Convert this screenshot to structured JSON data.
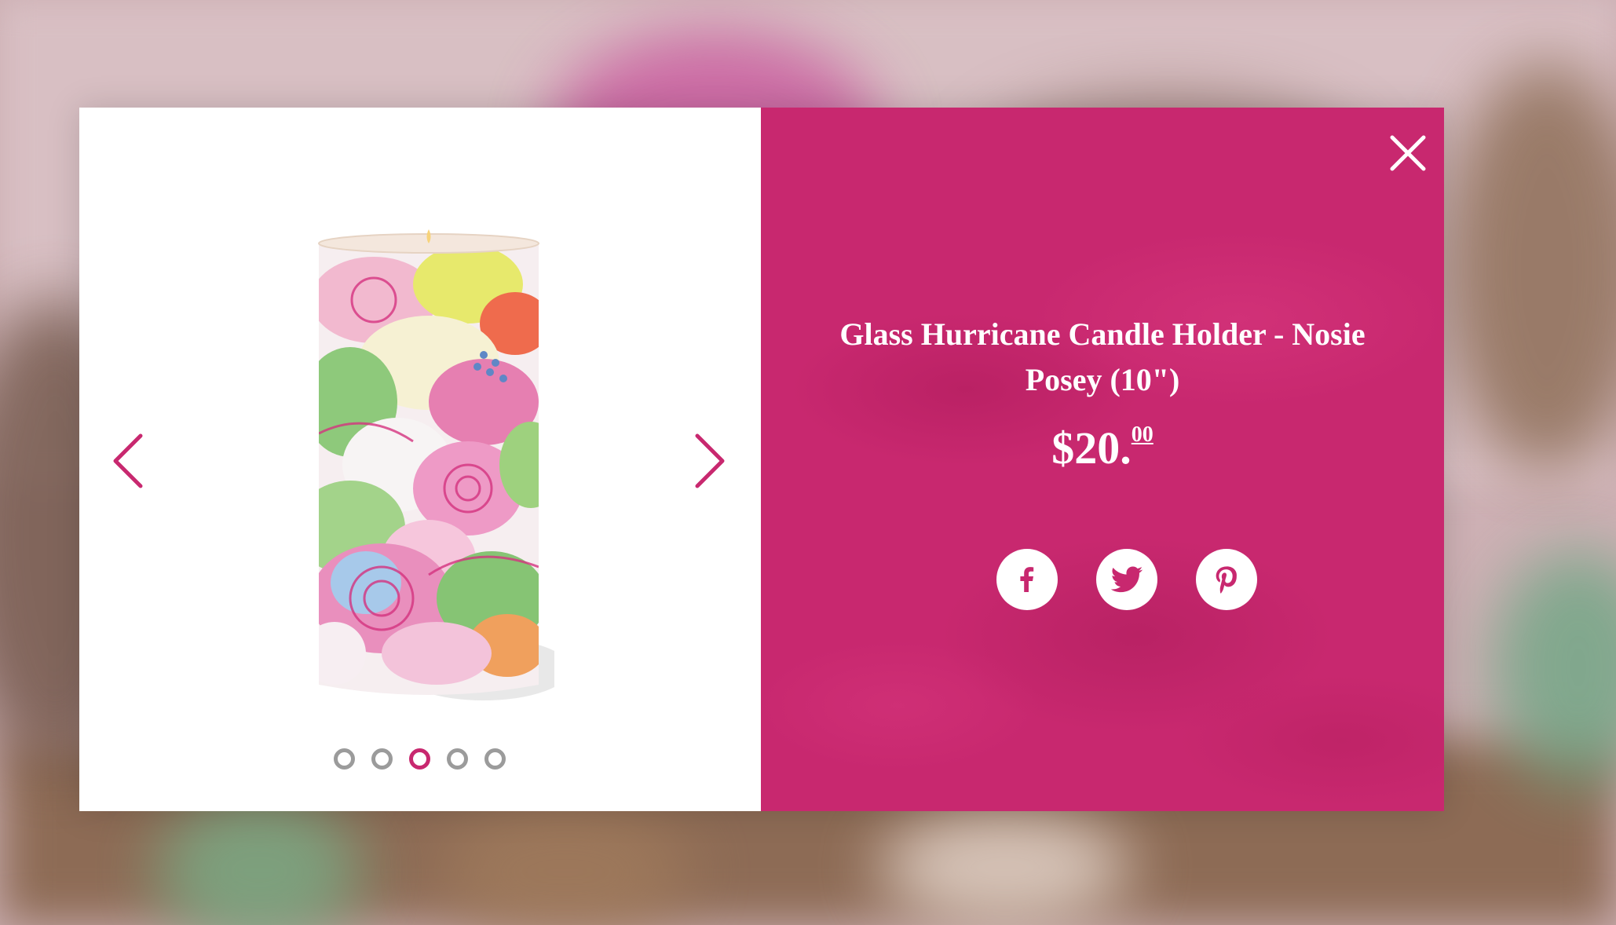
{
  "product": {
    "title": "Glass Hurricane Candle Holder - Nosie Posey (10\")",
    "price_main": "$20.",
    "price_cents": "00"
  },
  "gallery": {
    "slide_count": 5,
    "active_slide": 3
  },
  "colors": {
    "brand_pink": "#c8286f",
    "dot_inactive": "#9b9b9b"
  },
  "icons": {
    "prev": "chevron-left-icon",
    "next": "chevron-right-icon",
    "close": "close-icon",
    "share": [
      "facebook-icon",
      "twitter-icon",
      "pinterest-icon"
    ]
  }
}
